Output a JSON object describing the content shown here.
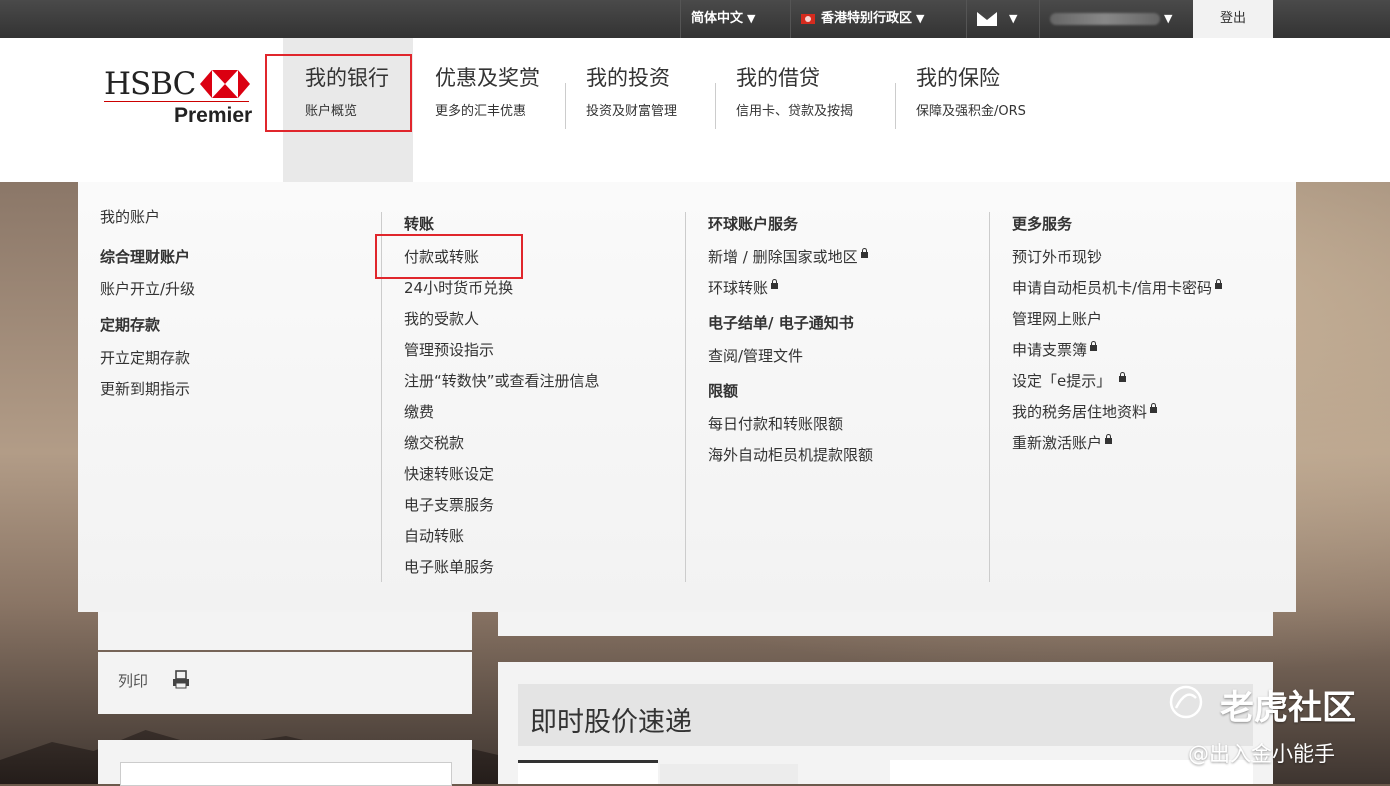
{
  "topbar": {
    "language": "简体中文",
    "region": "香港特别行政区",
    "logout": "登出"
  },
  "brand": {
    "name": "HSBC",
    "tier": "Premier"
  },
  "nav": [
    {
      "title": "我的银行",
      "sub": "账户概览"
    },
    {
      "title": "优惠及奖赏",
      "sub": "更多的汇丰优惠"
    },
    {
      "title": "我的投资",
      "sub": "投资及财富管理"
    },
    {
      "title": "我的借贷",
      "sub": "信用卡、贷款及按揭"
    },
    {
      "title": "我的保险",
      "sub": "保障及强积金/ORS"
    }
  ],
  "menu": {
    "col1": {
      "my_accounts": "我的账户",
      "h_integrated": "综合理财账户",
      "open_upgrade": "账户开立/升级",
      "h_deposit": "定期存款",
      "open_deposit": "开立定期存款",
      "renew": "更新到期指示"
    },
    "col2": {
      "heading": "转账",
      "items": [
        "付款或转账",
        "24小时货币兑换",
        "我的受款人",
        "管理预设指示",
        "注册“转数快”或查看注册信息",
        "缴费",
        "缴交税款",
        "快速转账设定",
        "电子支票服务",
        "自动转账",
        "电子账单服务"
      ]
    },
    "col3": {
      "heading": "环球账户服务",
      "add_remove": "新增 / 删除国家或地区",
      "global_transfer": "环球转账",
      "h_statements": "电子结单/ 电子通知书",
      "view_docs": "查阅/管理文件",
      "h_limits": "限额",
      "daily_limit": "每日付款和转账限额",
      "atm_limit": "海外自动柜员机提款限额"
    },
    "col4": {
      "heading": "更多服务",
      "foreign_cash": "预订外币现钞",
      "atm_pin": "申请自动柜员机卡/信用卡密码",
      "manage_online": "管理网上账户",
      "cheque_book": "申请支票簿",
      "e_alerts": "设定「e提示」",
      "tax_residency": "我的税务居住地资料",
      "reactivate": "重新激活账户"
    }
  },
  "page": {
    "print": "列印",
    "stock_quote": "即时股价速递"
  },
  "watermark": {
    "site": "老虎社区",
    "author": "@出入金小能手"
  },
  "colors": {
    "hsbc_red": "#db0011",
    "highlight_red": "#e0262c"
  }
}
